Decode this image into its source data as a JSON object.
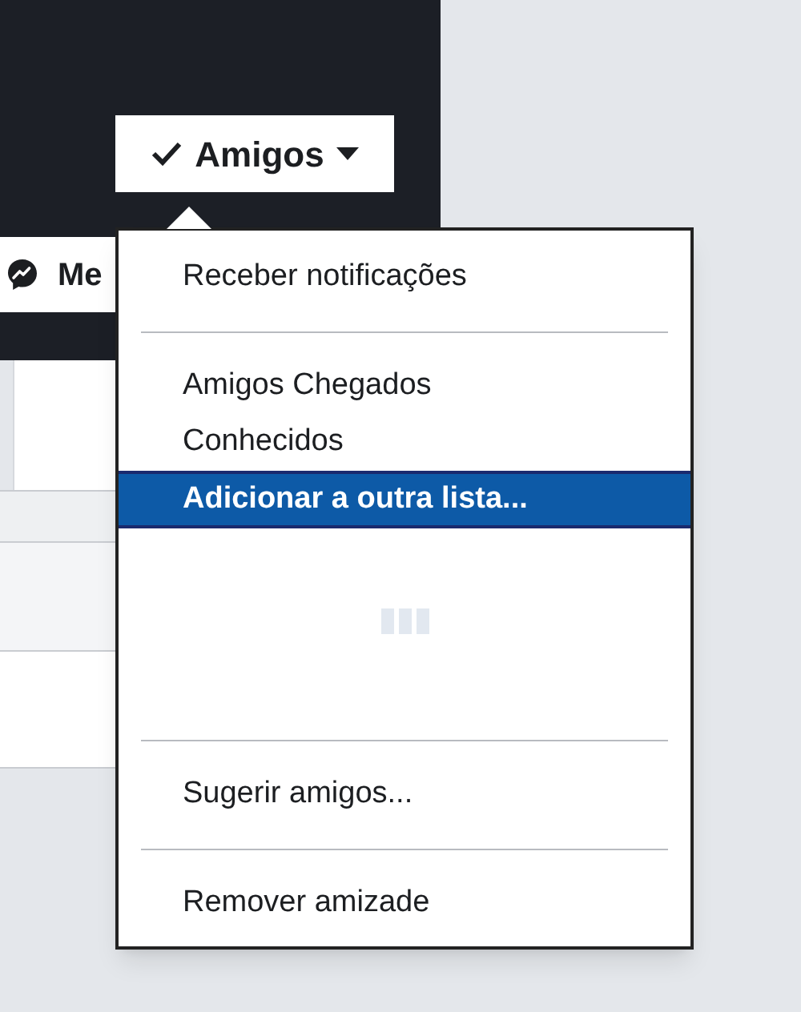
{
  "friend_button": {
    "label": "Amigos",
    "checked": true
  },
  "message_button": {
    "label": "Me"
  },
  "menu": {
    "items": [
      {
        "kind": "item",
        "label": "Receber notificações",
        "selected": false
      },
      {
        "kind": "separator"
      },
      {
        "kind": "item",
        "label": "Amigos Chegados",
        "selected": false
      },
      {
        "kind": "item",
        "label": "Conhecidos",
        "selected": false
      },
      {
        "kind": "item",
        "label": "Adicionar a outra lista...",
        "selected": true
      },
      {
        "kind": "loader"
      },
      {
        "kind": "separator"
      },
      {
        "kind": "item",
        "label": "Sugerir amigos...",
        "selected": false
      },
      {
        "kind": "separator"
      },
      {
        "kind": "item",
        "label": "Remover amizade",
        "selected": false
      }
    ]
  }
}
